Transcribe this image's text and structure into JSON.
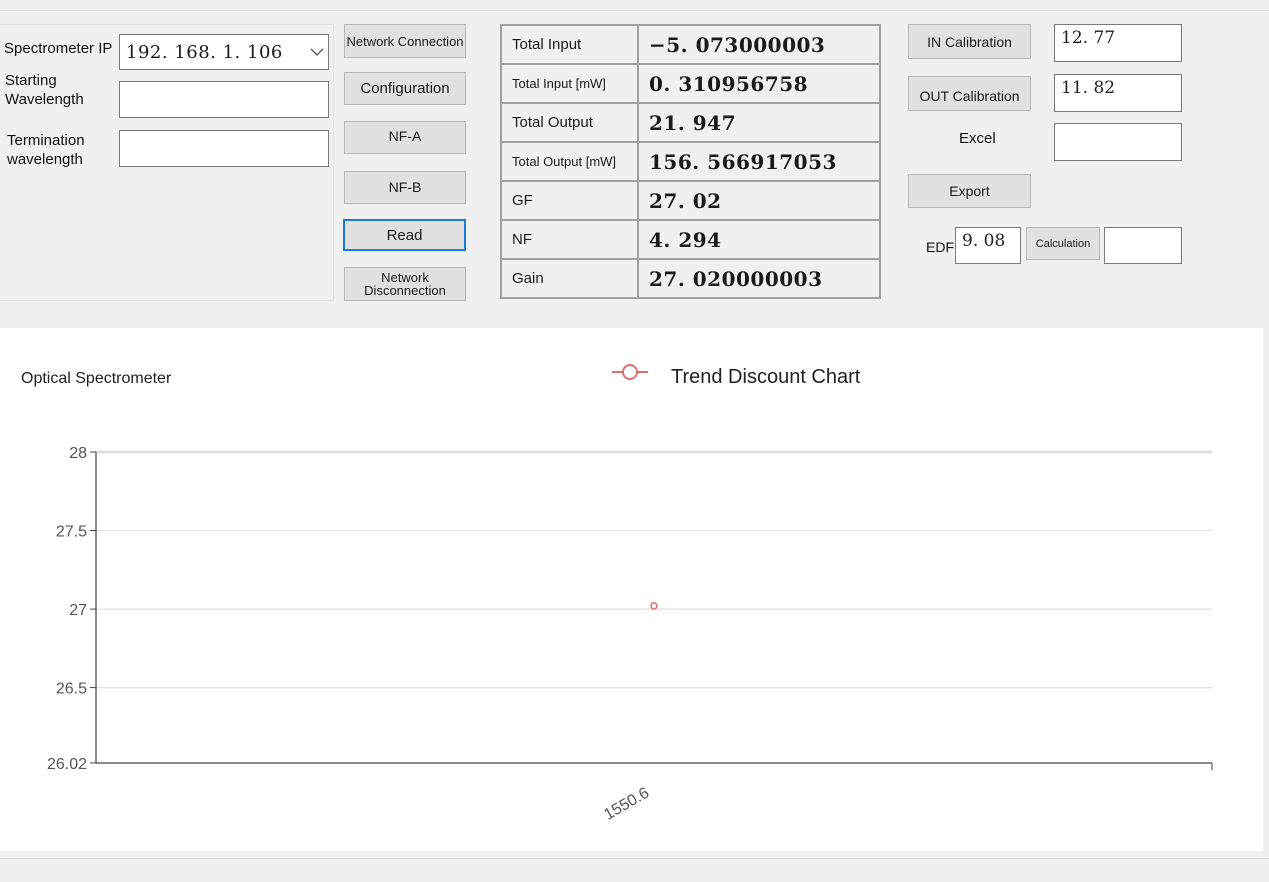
{
  "controls": {
    "spectrometer_ip_label": "Spectrometer IP",
    "spectrometer_ip_value": "192. 168. 1. 106",
    "starting_wavelength_label": "Starting Wavelength",
    "starting_wavelength_value": "",
    "termination_wavelength_label": "Termination wavelength",
    "termination_wavelength_value": ""
  },
  "buttons": {
    "network_connection": "Network Connection",
    "configuration": "Configuration",
    "nf_a": "NF-A",
    "nf_b": "NF-B",
    "read": "Read",
    "network_disconnection": "Network Disconnection",
    "in_calibration": "IN Calibration",
    "out_calibration": "OUT Calibration",
    "export": "Export",
    "calculation": "Calculation"
  },
  "measurements": [
    {
      "label": "Total Input",
      "value": "−5. 073000003"
    },
    {
      "label": "Total Input [mW]",
      "value": "0. 310956758"
    },
    {
      "label": "Total Output",
      "value": "21. 947"
    },
    {
      "label": "Total Output [mW]",
      "value": "156. 566917053"
    },
    {
      "label": "GF",
      "value": "27. 02"
    },
    {
      "label": "NF",
      "value": "4. 294"
    },
    {
      "label": "Gain",
      "value": "27. 020000003"
    }
  ],
  "right_panel": {
    "in_calibration_value": "12. 77",
    "out_calibration_value": "11. 82",
    "excel_label": "Excel",
    "excel_value": "",
    "edf_label": "EDF",
    "edf_value": "9. 08",
    "calculation_result": ""
  },
  "chart_data": {
    "type": "line",
    "title": "Optical Spectrometer",
    "legend_position": "top-center",
    "series": [
      {
        "name": "Trend Discount Chart",
        "color": "#e07070",
        "points": [
          {
            "x": "1550.6",
            "y": 27.02
          }
        ]
      }
    ],
    "categories": [
      "1550.6"
    ],
    "y_ticks": [
      "28",
      "27.5",
      "27",
      "26.5",
      "26.02"
    ],
    "ylim": [
      26.02,
      28
    ],
    "grid": true
  }
}
